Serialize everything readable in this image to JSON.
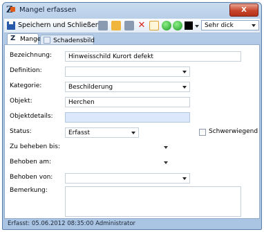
{
  "window": {
    "title": "Mangel erfassen",
    "close_symbol": "X"
  },
  "toolbar": {
    "save_close_label": "Speichern und Schließen",
    "line_style_value": "Sehr dick",
    "icons": [
      "save-icon",
      "folder-icon",
      "document-icon",
      "delete-icon",
      "frame-icon",
      "back-icon",
      "forward-icon",
      "color-icon"
    ]
  },
  "tabs": [
    {
      "label": "Mangel",
      "active": true
    },
    {
      "label": "Schadensbild",
      "active": false
    }
  ],
  "form": {
    "bezeichnung": {
      "label": "Bezeichnung:",
      "value": "Hinweisschild Kurort defekt"
    },
    "definition": {
      "label": "Definition:",
      "value": ""
    },
    "kategorie": {
      "label": "Kategorie:",
      "value": "Beschilderung"
    },
    "objekt": {
      "label": "Objekt:",
      "value": "Herchen"
    },
    "objektdetails": {
      "label": "Objektdetails:",
      "value": ""
    },
    "status": {
      "label": "Status:",
      "value": "Erfasst",
      "checkbox_label": "Schwerwiegend",
      "checked": false
    },
    "zu_beheben_bis": {
      "label": "Zu beheben bis:",
      "value": ""
    },
    "behoben_am": {
      "label": "Behoben am:",
      "value": ""
    },
    "behoben_von": {
      "label": "Behoben von:",
      "value": ""
    },
    "bemerkung": {
      "label": "Bemerkung:",
      "value": ""
    }
  },
  "status_bar": {
    "text": "Erfasst: 05.06.2012 08:35:00 Administrator"
  },
  "colors": {
    "title_gradient_top": "#c9dcef",
    "title_gradient_bottom": "#aac4e4",
    "close_button": "#c8452c",
    "highlight_field": "#dbe8fb"
  }
}
